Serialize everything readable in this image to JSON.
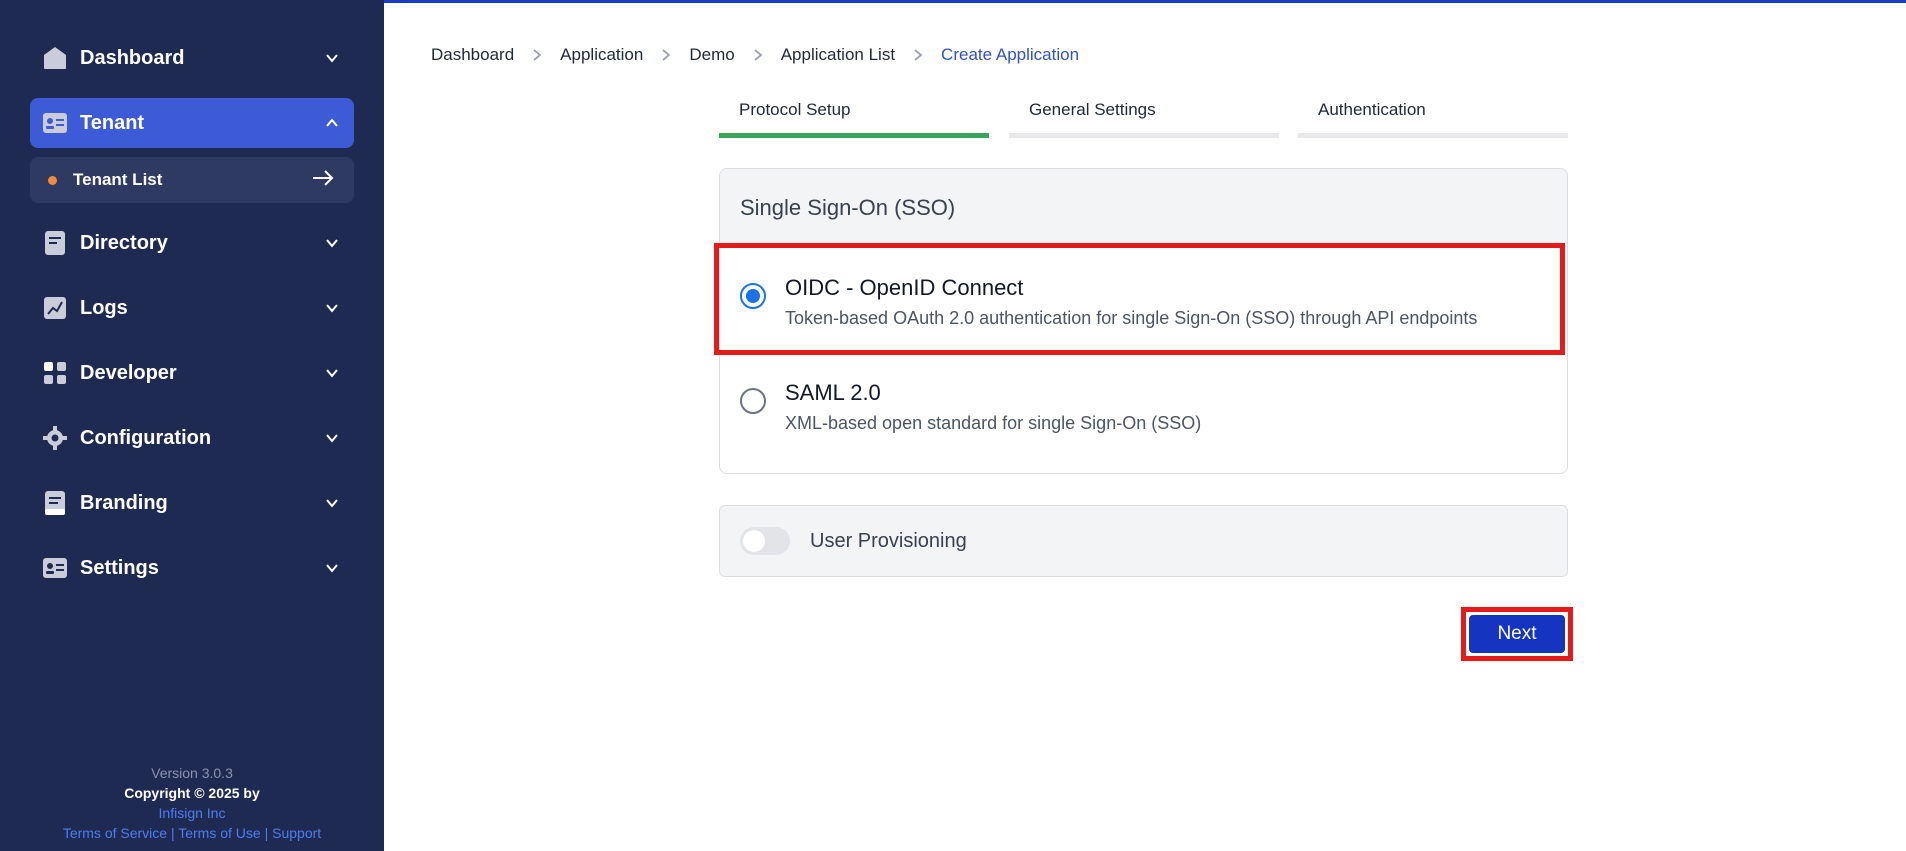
{
  "sidebar": {
    "items": [
      {
        "label": "Dashboard",
        "icon": "home-icon"
      },
      {
        "label": "Tenant",
        "icon": "id-card-icon"
      },
      {
        "label": "Directory",
        "icon": "document-icon"
      },
      {
        "label": "Logs",
        "icon": "chart-icon"
      },
      {
        "label": "Developer",
        "icon": "grid-icon"
      },
      {
        "label": "Configuration",
        "icon": "gear-icon"
      },
      {
        "label": "Branding",
        "icon": "branding-icon"
      },
      {
        "label": "Settings",
        "icon": "id-card-icon"
      }
    ],
    "sub_item": {
      "label": "Tenant List"
    },
    "footer": {
      "version": "Version 3.0.3",
      "copyright": "Copyright © 2025 by",
      "company": "Infisign Inc",
      "terms_service": "Terms of Service",
      "terms_use": "Terms of Use",
      "support": "Support",
      "separator": "|"
    }
  },
  "breadcrumb": [
    "Dashboard",
    "Application",
    "Demo",
    "Application List",
    "Create Application"
  ],
  "tabs": [
    {
      "label": "Protocol Setup",
      "active": true
    },
    {
      "label": "General Settings",
      "active": false
    },
    {
      "label": "Authentication",
      "active": false
    }
  ],
  "sso": {
    "title": "Single Sign-On (SSO)",
    "options": [
      {
        "title": "OIDC - OpenID Connect",
        "description": "Token-based OAuth 2.0 authentication for single Sign-On (SSO) through API endpoints",
        "selected": true
      },
      {
        "title": "SAML 2.0",
        "description": "XML-based open standard for single Sign-On (SSO)",
        "selected": false
      }
    ]
  },
  "provisioning": {
    "label": "User Provisioning",
    "enabled": false
  },
  "actions": {
    "next_label": "Next"
  },
  "colors": {
    "sidebar_bg": "#1f2a52",
    "active_item": "#3d5bd6",
    "primary_button": "#1634c2",
    "active_tab": "#3aa35c",
    "highlight": "#e41b1b"
  }
}
